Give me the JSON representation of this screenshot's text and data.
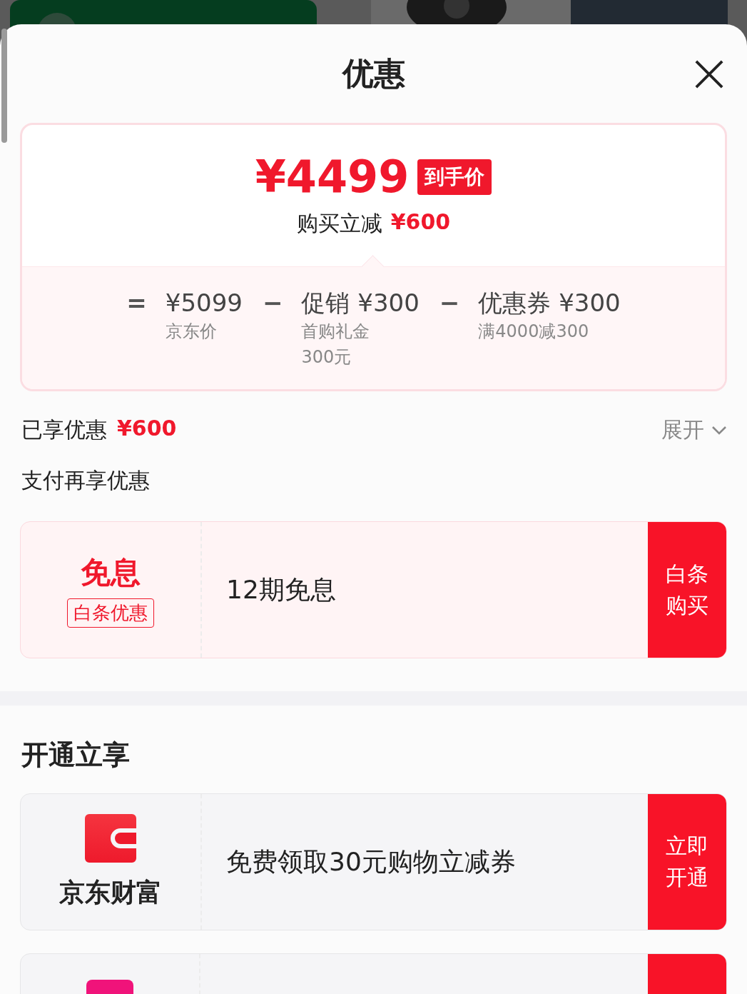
{
  "header": {
    "title": "优惠"
  },
  "price_card": {
    "price": "¥4499",
    "badge": "到手价",
    "subtitle": "购买立减",
    "subtitle_amount": "¥600",
    "breakdown": [
      {
        "operator": "=",
        "amount": "¥5099",
        "label": "京东价"
      },
      {
        "operator": "−",
        "amount": "促销 ¥300",
        "label": "首购礼金300元"
      },
      {
        "operator": "−",
        "amount": "优惠券 ¥300",
        "label": "满4000减300"
      }
    ]
  },
  "enjoyed": {
    "label": "已享优惠",
    "amount": "¥600",
    "toggle": "展开",
    "expanded": false
  },
  "payment_section": {
    "title": "支付再享优惠"
  },
  "payment_offers": [
    {
      "kind": "promo",
      "title": "免息",
      "tag": "白条优惠",
      "text": "12期免息",
      "button": "白条购买"
    }
  ],
  "open_section": {
    "title": "开通立享"
  },
  "open_offers": [
    {
      "kind": "wallet",
      "brand": "京东财富",
      "text": "免费领取30元购物立减券",
      "button": "立即开通"
    },
    {
      "kind": "partial"
    }
  ]
}
